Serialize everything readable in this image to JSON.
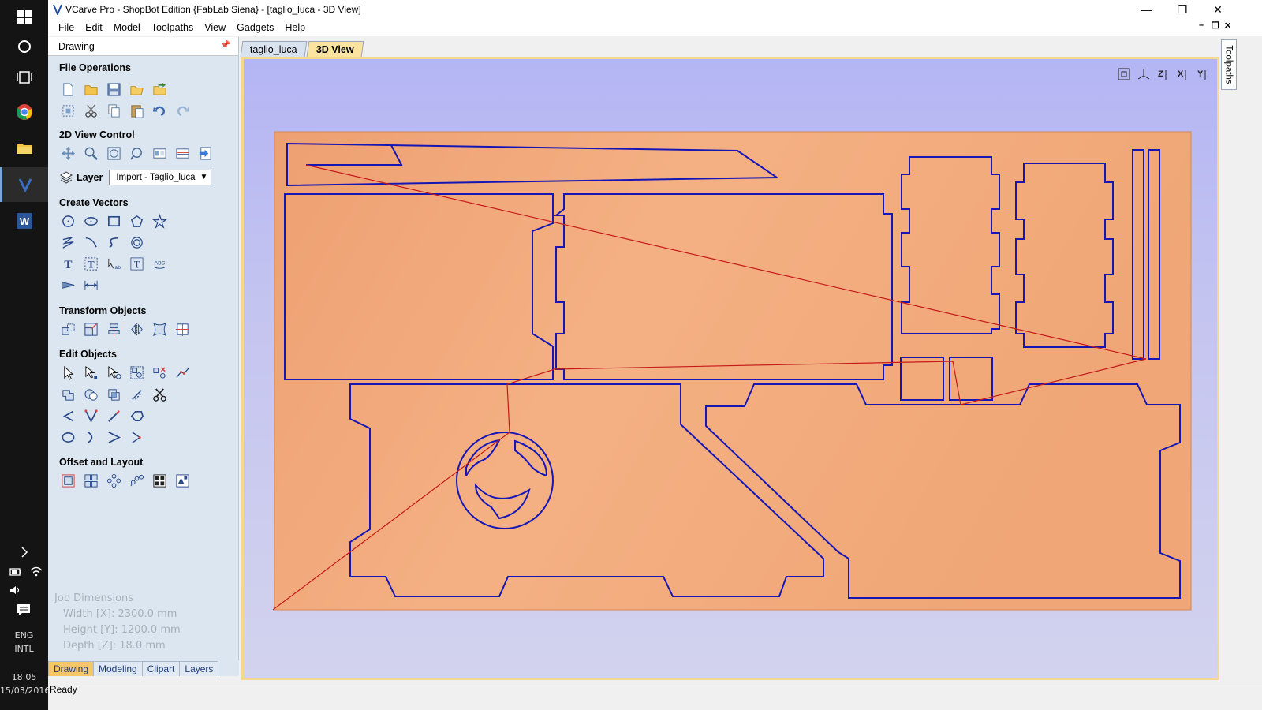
{
  "window": {
    "title": "VCarve Pro - ShopBot Edition {FabLab Siena} - [taglio_luca - 3D View]",
    "minimize": "—",
    "restore": "❐",
    "close": "✕"
  },
  "menu": [
    "File",
    "Edit",
    "Model",
    "Toolpaths",
    "View",
    "Gadgets",
    "Help"
  ],
  "mdi": {
    "minimize": "–",
    "restore": "❐",
    "close": "✕"
  },
  "panel": {
    "header": "Drawing",
    "sections": {
      "file_operations": "File Operations",
      "view_control": "2D View Control",
      "create_vectors": "Create Vectors",
      "transform_objects": "Transform Objects",
      "edit_objects": "Edit Objects",
      "offset_layout": "Offset and Layout"
    },
    "layer": {
      "label": "Layer",
      "value": "Import - Taglio_luca"
    },
    "job": {
      "title": "Job Dimensions",
      "width": "Width  [X]: 2300.0 mm",
      "height": "Height [Y]: 1200.0 mm",
      "depth": "Depth  [Z]: 18.0 mm"
    },
    "tabs": [
      "Drawing",
      "Modeling",
      "Clipart",
      "Layers"
    ]
  },
  "doc_tabs": [
    "taglio_luca",
    "3D View"
  ],
  "side_tab": "Toolpaths",
  "view_toolbar": [
    "fit-view",
    "iso-view",
    "z-view",
    "x-view",
    "y-view"
  ],
  "status": "Ready",
  "taskbar": {
    "lang": "ENG",
    "lang2": "INTL",
    "time": "18:05",
    "date": "15/03/2016"
  },
  "colors": {
    "wood": "#f0a878",
    "vector": "#1616b4",
    "toolpath": "#c41a1a",
    "panel": "#dce6f0",
    "active_tab": "#f6c768"
  }
}
